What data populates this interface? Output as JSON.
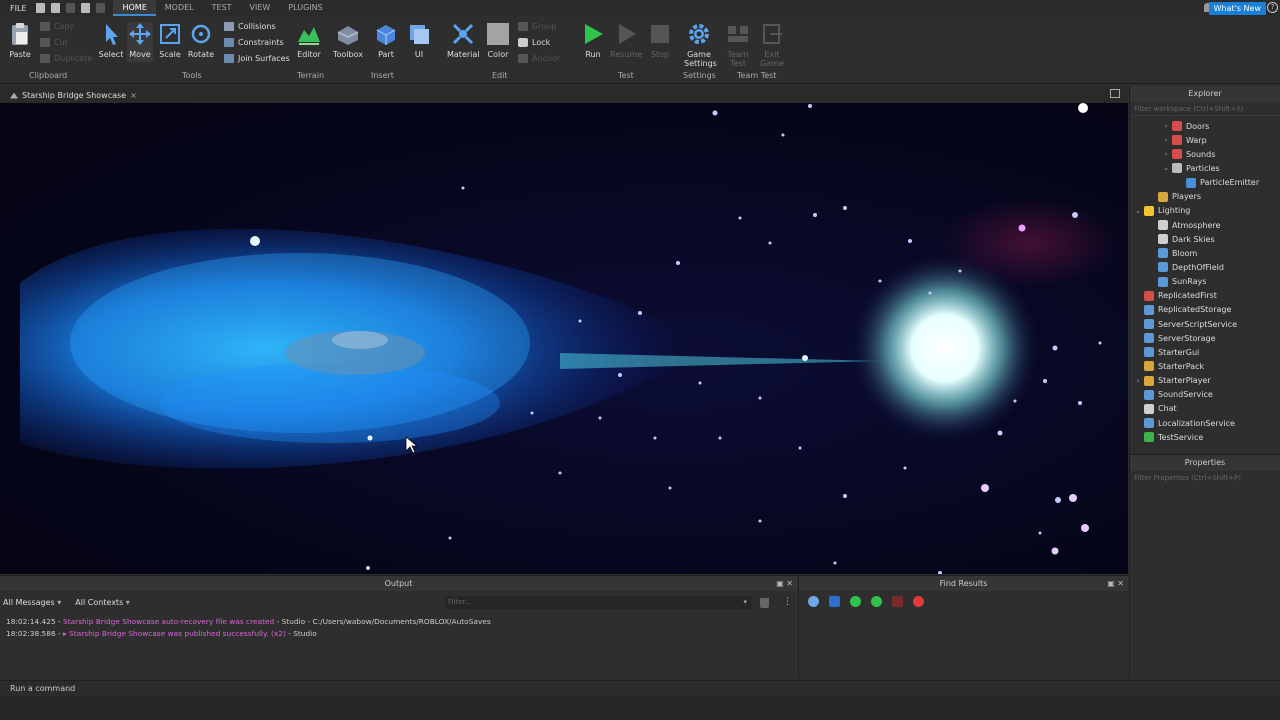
{
  "menu": {
    "file": "FILE",
    "tabs": [
      {
        "label": "HOME",
        "active": true
      },
      {
        "label": "MODEL",
        "active": false
      },
      {
        "label": "TEST",
        "active": false
      },
      {
        "label": "VIEW",
        "active": false
      },
      {
        "label": "PLUGINS",
        "active": false
      }
    ],
    "whats_new": "What's New"
  },
  "ribbon": {
    "paste": "Paste",
    "copy": "Copy",
    "cut": "Cut",
    "duplicate": "Duplicate",
    "clipboard": "Clipboard",
    "select": "Select",
    "move": "Move",
    "scale": "Scale",
    "rotate": "Rotate",
    "collisions": "Collisions",
    "constraints": "Constraints",
    "join_surfaces": "Join Surfaces",
    "tools": "Tools",
    "editor": "Editor",
    "terrain": "Terrain",
    "toolbox": "Toolbox",
    "part": "Part",
    "ui": "UI",
    "insert": "Insert",
    "material": "Material",
    "color": "Color",
    "group": "Group",
    "lock": "Lock",
    "anchor": "Anchor",
    "edit": "Edit",
    "run": "Run",
    "resume": "Resume",
    "stop": "Stop",
    "test": "Test",
    "game_settings_1": "Game",
    "game_settings_2": "Settings",
    "settings": "Settings",
    "team_test_1": "Team",
    "team_test_2": "Test",
    "exit_game_1": "Exit",
    "exit_game_2": "Game",
    "team_test": "Team Test"
  },
  "doc_tab": {
    "title": "Starship Bridge Showcase",
    "close": "×"
  },
  "explorer": {
    "title": "Explorer",
    "filter_placeholder": "Filter workspace (Ctrl+Shift+X)",
    "items": [
      {
        "label": "Doors",
        "indent": 2,
        "arrow": "›",
        "color": "#d94c4c"
      },
      {
        "label": "Warp",
        "indent": 2,
        "arrow": "›",
        "color": "#d94c4c"
      },
      {
        "label": "Sounds",
        "indent": 2,
        "arrow": "›",
        "color": "#d94c4c"
      },
      {
        "label": "Particles",
        "indent": 2,
        "arrow": "⌄",
        "color": "#bbbbbb"
      },
      {
        "label": "ParticleEmitter",
        "indent": 3,
        "arrow": "",
        "color": "#4a90d9"
      },
      {
        "label": "Players",
        "indent": 1,
        "arrow": "",
        "color": "#d8a63a"
      },
      {
        "label": "Lighting",
        "indent": 0,
        "arrow": "⌄",
        "color": "#f0c530"
      },
      {
        "label": "Atmosphere",
        "indent": 1,
        "arrow": "",
        "color": "#cfcfcf"
      },
      {
        "label": "Dark Skies",
        "indent": 1,
        "arrow": "",
        "color": "#cfcfcf"
      },
      {
        "label": "Bloom",
        "indent": 1,
        "arrow": "",
        "color": "#5b9ad6"
      },
      {
        "label": "DepthOfField",
        "indent": 1,
        "arrow": "",
        "color": "#5b9ad6"
      },
      {
        "label": "SunRays",
        "indent": 1,
        "arrow": "",
        "color": "#5b9ad6"
      },
      {
        "label": "ReplicatedFirst",
        "indent": 0,
        "arrow": "",
        "color": "#d94c4c"
      },
      {
        "label": "ReplicatedStorage",
        "indent": 0,
        "arrow": "",
        "color": "#5b9ad6"
      },
      {
        "label": "ServerScriptService",
        "indent": 0,
        "arrow": "",
        "color": "#5b9ad6"
      },
      {
        "label": "ServerStorage",
        "indent": 0,
        "arrow": "",
        "color": "#5b9ad6"
      },
      {
        "label": "StarterGui",
        "indent": 0,
        "arrow": "",
        "color": "#5b9ad6"
      },
      {
        "label": "StarterPack",
        "indent": 0,
        "arrow": "",
        "color": "#d8a63a"
      },
      {
        "label": "StarterPlayer",
        "indent": 0,
        "arrow": "›",
        "color": "#d8a63a"
      },
      {
        "label": "SoundService",
        "indent": 0,
        "arrow": "",
        "color": "#5b9ad6"
      },
      {
        "label": "Chat",
        "indent": 0,
        "arrow": "",
        "color": "#cfcfcf"
      },
      {
        "label": "LocalizationService",
        "indent": 0,
        "arrow": "",
        "color": "#5b9ad6"
      },
      {
        "label": "TestService",
        "indent": 0,
        "arrow": "",
        "color": "#3bb54a"
      }
    ]
  },
  "properties": {
    "title": "Properties",
    "filter_placeholder": "Filter Properties (Ctrl+Shift+P)"
  },
  "output": {
    "title": "Output",
    "all_messages": "All Messages",
    "all_contexts": "All Contexts",
    "filter_placeholder": "Filter...",
    "controls": "▣ ✕",
    "logs": [
      {
        "time": "18:02:14.425",
        "msg": "Starship Bridge Showcase auto-recovery file was created",
        "rest": " - Studio  -  C:/Users/wabow/Documents/ROBLOX/AutoSaves"
      },
      {
        "time": "18:02:38.586",
        "msg": "▸ Starship Bridge Showcase was published successfully. (x2)",
        "rest": " - Studio"
      }
    ]
  },
  "find": {
    "title": "Find Results",
    "controls": "▣ ✕"
  },
  "command": {
    "placeholder": "Run a command"
  }
}
